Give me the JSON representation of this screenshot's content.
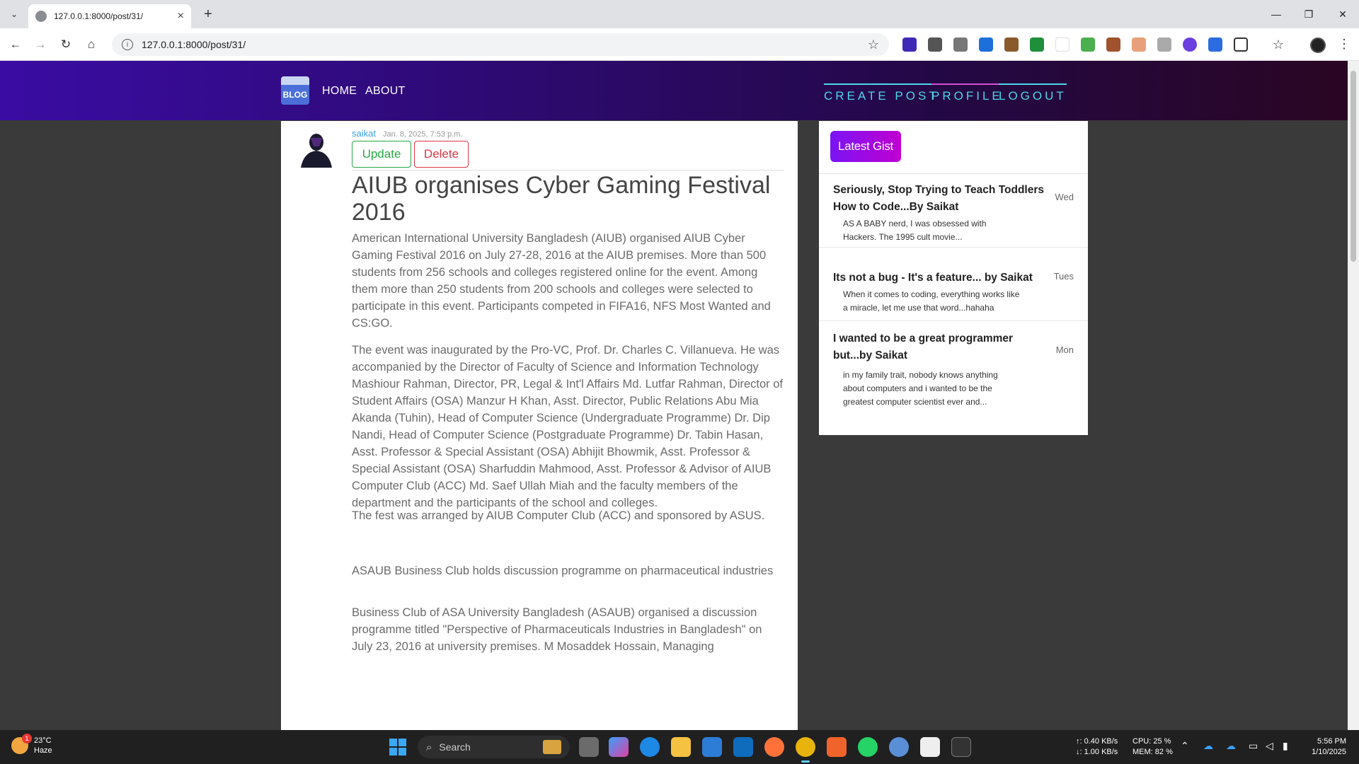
{
  "browser": {
    "tab_title": "127.0.0.1:8000/post/31/",
    "address": "127.0.0.1:8000/post/31/"
  },
  "nav": {
    "brand": "BLOG",
    "left": [
      "HOME",
      "ABOUT"
    ],
    "right": [
      "CREATE POST",
      "PROFILE",
      "LOGOUT"
    ]
  },
  "post": {
    "author": "saikat",
    "date": "Jan. 8, 2025, 7:53 p.m.",
    "update_label": "Update",
    "delete_label": "Delete",
    "title": "AIUB organises Cyber Gaming Festival 2016",
    "paragraphs": [
      "American International University Bangladesh (AIUB) organised AIUB Cyber Gaming Festival 2016 on July 27-28, 2016 at the AIUB premises. More than 500 students from 256 schools and colleges registered online for the event. Among them more than 250 students from 200 schools and colleges were selected to participate in this event. Participants competed in FIFA16, NFS Most Wanted and CS:GO.",
      "The event was inaugurated by the Pro-VC, Prof. Dr. Charles C. Villanueva. He was accompanied by the Director of Faculty of Science and Information Technology Mashiour Rahman, Director, PR, Legal & Int'l Affairs Md. Lutfar Rahman, Director of Student Affairs (OSA) Manzur H Khan, Asst. Director, Public Relations Abu Mia Akanda (Tuhin), Head of Computer Science (Undergraduate Programme) Dr. Dip Nandi, Head of Computer Science (Postgraduate Programme) Dr. Tabin Hasan, Asst. Professor & Special Assistant (OSA) Abhijit Bhowmik, Asst. Professor & Special Assistant (OSA) Sharfuddin Mahmood, Asst. Professor & Advisor of AIUB Computer Club (ACC) Md. Saef Ullah Miah and the faculty members of the department and the participants of the school and colleges.",
      "The fest was arranged by AIUB Computer Club (ACC) and sponsored by ASUS.",
      "ASAUB Business Club holds discussion programme on pharmaceutical industries",
      "Business Club of ASA University Bangladesh (ASAUB) organised a discussion programme titled \"Perspective of Pharmaceuticals Industries in Bangladesh\" on July 23, 2016 at university premises. M Mosaddek Hossain, Managing"
    ]
  },
  "sidebar": {
    "badge": "Latest Gist",
    "gists": [
      {
        "title": "Seriously, Stop Trying to Teach Toddlers How to Code...By Saikat",
        "day": "Wed",
        "excerpt": "AS A BABY nerd, I was obsessed with Hackers. The 1995 cult movie..."
      },
      {
        "title": "Its not a bug - It's a feature... by Saikat",
        "day": "Tues",
        "excerpt": "When it comes to coding, everything works like a miracle, let me use that word...hahaha"
      },
      {
        "title": "I wanted to be a great programmer but...by Saikat",
        "day": "Mon",
        "excerpt": "in my family trait, nobody knows anything about computers and i wanted to be the greatest computer scientist ever and..."
      }
    ]
  },
  "taskbar": {
    "weather_temp": "23°C",
    "weather_desc": "Haze",
    "weather_badge": "1",
    "search": "Search",
    "net_up": "↑: 0.40 KB/s",
    "net_down": "↓: 1.00 KB/s",
    "cpu": "CPU: 25 %",
    "mem": "MEM: 82 %",
    "time": "5:56 PM",
    "date": "1/10/2025"
  },
  "colors": {
    "nav_gradient_start": "#3a0ca3",
    "nav_gradient_end": "#2a0623",
    "nav_right_link": "#4dd6e8",
    "update": "#28a745",
    "delete": "#dc3545",
    "gist_badge": "#7a14f5"
  }
}
